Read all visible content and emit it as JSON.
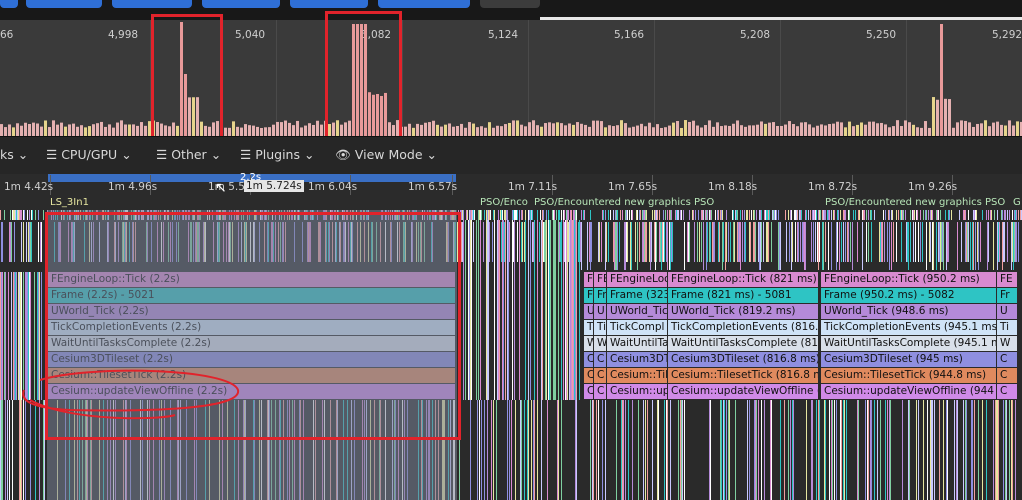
{
  "frames_chart": {
    "tick_labels": [
      "66",
      "4,998",
      "5,040",
      "5,082",
      "5,124",
      "5,166",
      "5,208",
      "5,250",
      "5,292"
    ]
  },
  "toolbar": {
    "tracks_label": "ks",
    "cpu_gpu_label": "CPU/GPU",
    "other_label": "Other",
    "plugins_label": "Plugins",
    "view_mode_label": "View Mode"
  },
  "timeline": {
    "selection_duration": "2.2s",
    "hover_time": "1m 5.724s",
    "ruler_labels": [
      "1m 4.42s",
      "1m 4.96s",
      "1m 5.5",
      "1m 6.04s",
      "1m 6.57s",
      "1m 7.11s",
      "1m 7.65s",
      "1m 8.18s",
      "1m 8.72s",
      "1m 9.26s"
    ],
    "markers": [
      "LS_3In1",
      "PSO/Enco",
      "PSO/Encountered new graphics PSO",
      "PSO/Encountered new graphics PSO",
      "G"
    ]
  },
  "events_left": [
    "FEngineLoop::Tick (2.2s)",
    "Frame (2.2s)  -  5021",
    "UWorld_Tick (2.2s)",
    "TickCompletionEvents (2.2s)",
    "WaitUntilTasksComplete (2.2s)",
    "Cesium3DTileset (2.2s)",
    "Cesium::TilesetTick (2.2s)",
    "Cesium::updateViewOffline (2.2s)"
  ],
  "events_mid_a": [
    "FEngineLoo",
    "Frame (323",
    "UWorld_Tic",
    "TickCompl",
    "WaitUntilTa",
    "Cesium3DT",
    "Cesium::Til",
    "Cesium::up"
  ],
  "events_mid_b": [
    "FEngineLoop::Tick (821 ms)",
    "Frame (821 ms)  -  5081",
    "UWorld_Tick (819.2 ms)",
    "TickCompletionEvents (816.8",
    "WaitUntilTasksComplete (816",
    "Cesium3DTileset (816.8 ms)",
    "Cesium::TilesetTick (816.8 m",
    "Cesium::updateViewOffline (8"
  ],
  "events_right": [
    "FEngineLoop::Tick (950.2 ms)",
    "Frame (950.2 ms)  -  5082",
    "UWorld_Tick (948.6 ms)",
    "TickCompletionEvents (945.1 ms)",
    "WaitUntilTasksComplete (945.1 m",
    "Cesium3DTileset (945 ms)",
    "Cesium::TilesetTick (944.8 ms)",
    "Cesium::updateViewOffline (944"
  ],
  "events_small_a": [
    "F",
    "Fr",
    "U",
    "T",
    "W",
    "C",
    "C",
    "C"
  ],
  "events_small_b": [
    "FE",
    "Fr",
    "U",
    "Ti",
    "W",
    "C",
    "C",
    "C"
  ],
  "events_small_c": [
    "FE",
    "Fr",
    "U",
    "Ti",
    "W",
    "C",
    "C",
    "C"
  ],
  "colors": {
    "engine_tick": "#d98ad0",
    "frame": "#2ec4c4",
    "uworld": "#b58ad9",
    "tick_completion": "#cfe3f7",
    "wait_until": "#d9e0ea",
    "cesium_tileset": "#8f8fe0",
    "cesium_tilesettick": "#e08a5e",
    "cesium_update": "#d08ae8",
    "annotation_red": "#e1232b"
  }
}
